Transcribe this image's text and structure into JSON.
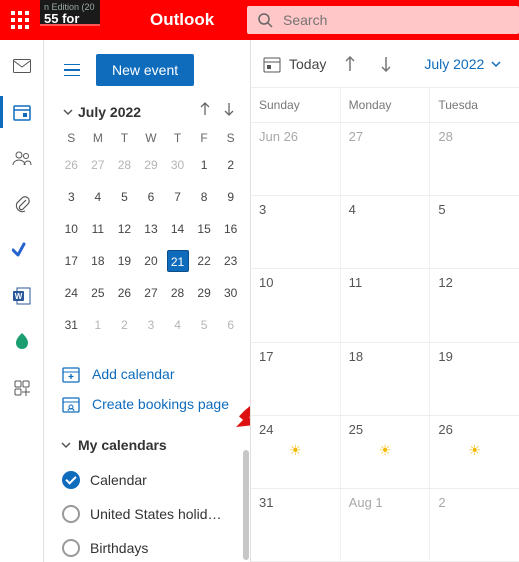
{
  "colors": {
    "accent": "#0f6cbd",
    "topbar": "#f00"
  },
  "topbar": {
    "title": "Outlook",
    "ad_line1": "n Edition (20",
    "ad_line2": "55 for",
    "search_placeholder": "Search"
  },
  "rail": {
    "items": [
      {
        "name": "mail-icon"
      },
      {
        "name": "calendar-icon",
        "active": true
      },
      {
        "name": "people-icon"
      },
      {
        "name": "attachments-icon"
      },
      {
        "name": "todo-icon"
      },
      {
        "name": "word-icon"
      },
      {
        "name": "bookings-icon"
      },
      {
        "name": "more-apps-icon"
      }
    ]
  },
  "sidepanel": {
    "new_event": "New event",
    "mini_month_label": "July 2022",
    "weekdays": [
      "S",
      "M",
      "T",
      "W",
      "T",
      "F",
      "S"
    ],
    "grid": [
      [
        {
          "d": 26,
          "dim": true
        },
        {
          "d": 27,
          "dim": true
        },
        {
          "d": 28,
          "dim": true
        },
        {
          "d": 29,
          "dim": true
        },
        {
          "d": 30,
          "dim": true
        },
        {
          "d": 1
        },
        {
          "d": 2
        }
      ],
      [
        {
          "d": 3
        },
        {
          "d": 4
        },
        {
          "d": 5
        },
        {
          "d": 6
        },
        {
          "d": 7
        },
        {
          "d": 8
        },
        {
          "d": 9
        }
      ],
      [
        {
          "d": 10
        },
        {
          "d": 11
        },
        {
          "d": 12
        },
        {
          "d": 13
        },
        {
          "d": 14
        },
        {
          "d": 15
        },
        {
          "d": 16
        }
      ],
      [
        {
          "d": 17
        },
        {
          "d": 18
        },
        {
          "d": 19
        },
        {
          "d": 20
        },
        {
          "d": 21,
          "today": true
        },
        {
          "d": 22
        },
        {
          "d": 23
        }
      ],
      [
        {
          "d": 24
        },
        {
          "d": 25
        },
        {
          "d": 26
        },
        {
          "d": 27
        },
        {
          "d": 28
        },
        {
          "d": 29
        },
        {
          "d": 30
        }
      ],
      [
        {
          "d": 31
        },
        {
          "d": 1,
          "dim": true
        },
        {
          "d": 2,
          "dim": true
        },
        {
          "d": 3,
          "dim": true
        },
        {
          "d": 4,
          "dim": true
        },
        {
          "d": 5,
          "dim": true
        },
        {
          "d": 6,
          "dim": true
        }
      ]
    ],
    "links": {
      "add_calendar": "Add calendar",
      "create_bookings": "Create bookings page"
    },
    "section_title": "My calendars",
    "calendars": [
      {
        "label": "Calendar",
        "checked": true
      },
      {
        "label": "United States holid…",
        "checked": false
      },
      {
        "label": "Birthdays",
        "checked": false
      }
    ]
  },
  "main": {
    "today": "Today",
    "month_label": "July 2022",
    "weekday_headers": [
      "Sunday",
      "Monday",
      "Tuesda"
    ],
    "weeks": [
      [
        {
          "label": "Jun 26",
          "dim": true
        },
        {
          "label": "27",
          "dim": true
        },
        {
          "label": "28",
          "dim": true
        }
      ],
      [
        {
          "label": "3"
        },
        {
          "label": "4"
        },
        {
          "label": "5"
        }
      ],
      [
        {
          "label": "10"
        },
        {
          "label": "11"
        },
        {
          "label": "12"
        }
      ],
      [
        {
          "label": "17"
        },
        {
          "label": "18"
        },
        {
          "label": "19"
        }
      ],
      [
        {
          "label": "24",
          "sun": true
        },
        {
          "label": "25",
          "sun": true
        },
        {
          "label": "26",
          "sun": true
        }
      ],
      [
        {
          "label": "31"
        },
        {
          "label": "Aug 1",
          "dim": true
        },
        {
          "label": "2",
          "dim": true
        }
      ]
    ]
  }
}
